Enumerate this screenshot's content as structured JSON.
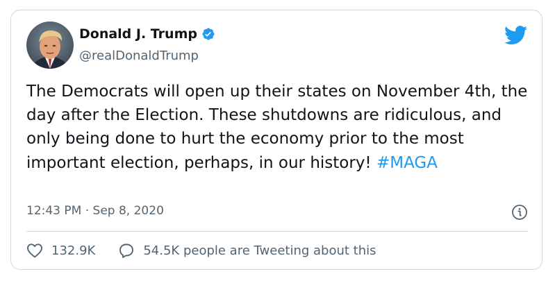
{
  "author": {
    "display_name": "Donald J. Trump",
    "handle": "@realDonaldTrump",
    "verified": true,
    "avatar": "profile-photo"
  },
  "tweet": {
    "text": "The Democrats will open up their states on November 4th, the day after the Election. These shutdowns are ridiculous, and only being done to hurt the economy prior to the most important election, perhaps, in our history! ",
    "hashtag": "#MAGA"
  },
  "meta": {
    "time": "12:43 PM",
    "separator": " · ",
    "date": "Sep 8, 2020"
  },
  "actions": {
    "likes": "132.9K",
    "conversation": "54.5K people are Tweeting about this"
  },
  "icons": {
    "brand": "twitter-bird-icon",
    "verified": "verified-badge-icon",
    "info": "info-icon",
    "like": "heart-icon",
    "reply": "speech-bubble-icon"
  },
  "colors": {
    "brand_blue": "#1d9bf0",
    "text_primary": "#0f1419",
    "text_secondary": "#536471",
    "border": "#cfd9de"
  }
}
